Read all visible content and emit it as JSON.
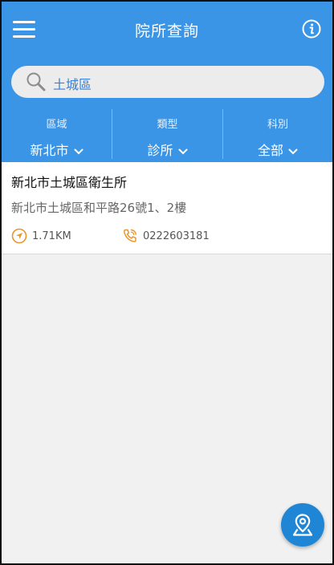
{
  "header": {
    "title": "院所查詢"
  },
  "search": {
    "value": "土城區"
  },
  "filters": [
    {
      "label": "區域",
      "value": "新北市"
    },
    {
      "label": "類型",
      "value": "診所"
    },
    {
      "label": "科別",
      "value": "全部"
    }
  ],
  "results": [
    {
      "name": "新北市土城區衛生所",
      "address": "新北市土城區和平路26號1、2樓",
      "distance": "1.71KM",
      "phone": "0222603181"
    }
  ],
  "colors": {
    "primary": "#3b95e6",
    "accent_orange": "#e8962e",
    "fab": "#1f86d6"
  },
  "icons": {
    "menu": "hamburger-icon",
    "info": "info-icon",
    "search": "search-icon",
    "distance": "navigation-arrow-icon",
    "phone": "phone-icon",
    "map": "map-pin-icon"
  }
}
